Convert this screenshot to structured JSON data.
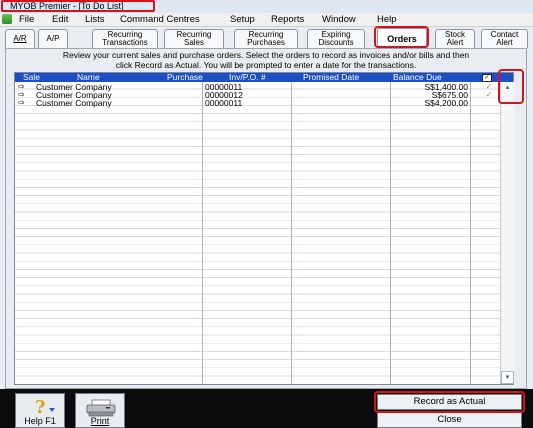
{
  "window": {
    "title": "MYOB Premier - [To Do List]"
  },
  "menu": [
    "File",
    "Edit",
    "Lists",
    "Command Centres",
    "Setup",
    "Reports",
    "Window",
    "Help"
  ],
  "tabs": [
    {
      "line1": "A/R",
      "line2": ""
    },
    {
      "line1": "A/P",
      "line2": ""
    },
    {
      "line1": "Recurring",
      "line2": "Transactions"
    },
    {
      "line1": "Recurring",
      "line2": "Sales"
    },
    {
      "line1": "Recurring",
      "line2": "Purchases"
    },
    {
      "line1": "Expiring",
      "line2": "Discounts"
    },
    {
      "line1": "Orders",
      "line2": ""
    },
    {
      "line1": "Stock",
      "line2": "Alert"
    },
    {
      "line1": "Contact",
      "line2": "Alert"
    }
  ],
  "instructions": {
    "line1": "Review your current sales and purchase orders.  Select the orders to record as invoices and/or bills and then",
    "line2": "click Record as Actual. You will be prompted to enter a date for the transactions."
  },
  "table": {
    "columns": [
      "Sale",
      "Name",
      "Purchase",
      "Inv/P.O. #",
      "Promised Date",
      "Balance Due"
    ],
    "rows": [
      {
        "name": "Customer Company",
        "purchase": "",
        "inv": "00000011",
        "promised": "",
        "balance": "S$1,400.00",
        "checked": true
      },
      {
        "name": "Customer Company",
        "purchase": "",
        "inv": "00000012",
        "promised": "",
        "balance": "S$675.00",
        "checked": true
      },
      {
        "name": "Customer Company",
        "purchase": "",
        "inv": "00000011",
        "promised": "",
        "balance": "S$4,200.00",
        "checked": false
      }
    ],
    "row_arrow": "⇨",
    "check_mark": "✓"
  },
  "buttons": {
    "help": "Help F1",
    "print": "Print",
    "record": "Record as Actual",
    "close": "Close"
  },
  "colors": {
    "header": "#1d4fc3",
    "highlight": "#d8121a"
  }
}
